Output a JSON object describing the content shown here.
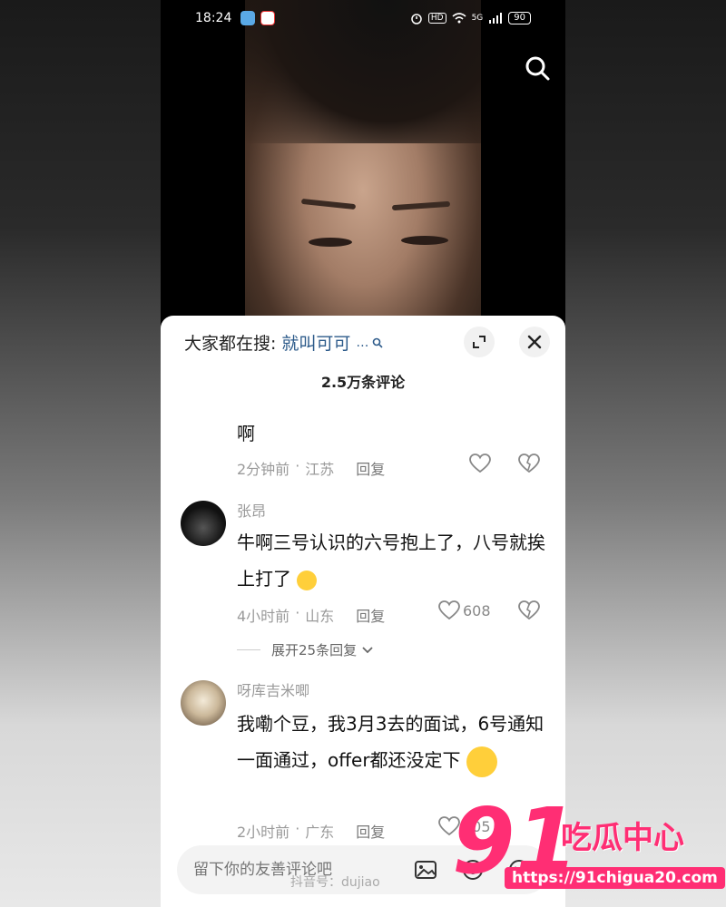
{
  "status_bar": {
    "time": "18:24",
    "network": "HD",
    "signal": "5G",
    "battery": "90"
  },
  "search_bar": {
    "label": "大家都在搜:",
    "keyword": "就叫可可",
    "more": "…"
  },
  "comments_header": {
    "count_text": "2.5万条评论"
  },
  "comments": [
    {
      "user": "",
      "text": "啊",
      "time": "2分钟前",
      "location": "江苏",
      "reply": "回复",
      "likes": ""
    },
    {
      "user": "张昂",
      "text": "牛啊三号认识的六号抱上了，八号就挨上打了",
      "time": "4小时前",
      "location": "山东",
      "reply": "回复",
      "likes": "608",
      "expand": "展开25条回复"
    },
    {
      "user": "呀库吉米唧",
      "text": "我嘞个豆，我3月3去的面试，6号通知一面通过，offer都还没定下",
      "time": "2小时前",
      "location": "广东",
      "reply": "回复",
      "likes": "505"
    }
  ],
  "input": {
    "placeholder": "留下你的友善评论吧"
  },
  "watermark": {
    "number": "91",
    "title": "吃瓜中心",
    "url": "https://91chigua20.com",
    "douyin": "抖音号：dujiao"
  },
  "colors": {
    "accent": "#ff2e74",
    "link": "#2c5a8a",
    "meta": "#9a9a9a"
  }
}
